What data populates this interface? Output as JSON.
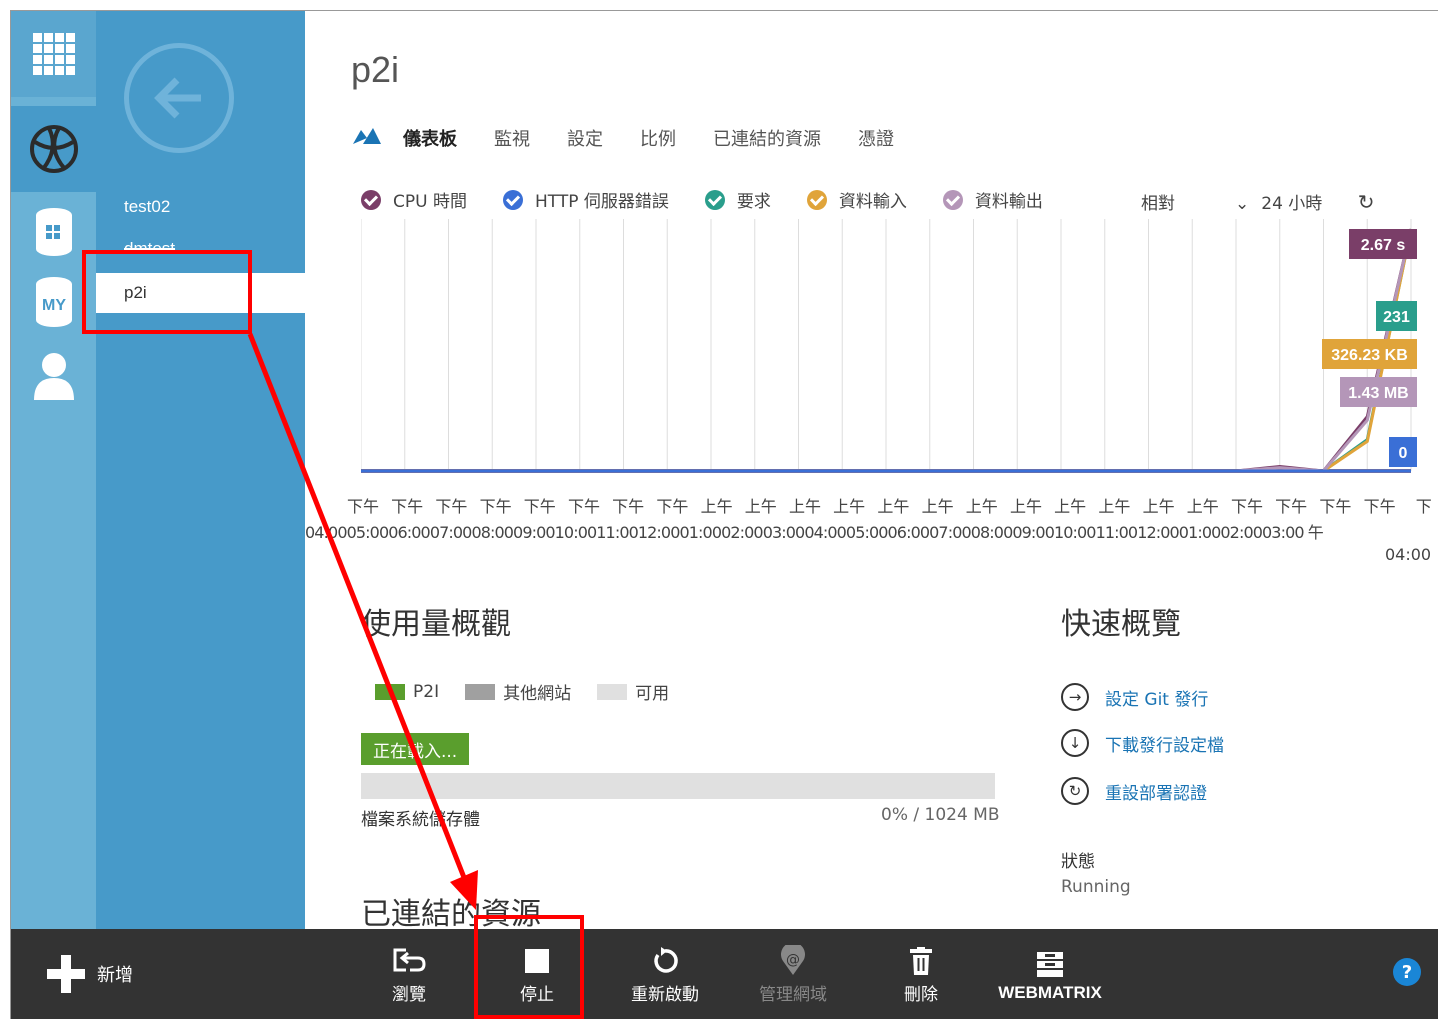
{
  "sidebar": {
    "icons": [
      "all-items-icon",
      "websites-icon",
      "sql-database-icon",
      "my-icon",
      "user-icon"
    ],
    "my_label": "MY",
    "sites": [
      {
        "label": "test02"
      },
      {
        "label": "dmtest"
      },
      {
        "label": "p2i",
        "selected": true
      }
    ]
  },
  "page": {
    "title": "p2i",
    "tabs": [
      "儀表板",
      "監視",
      "設定",
      "比例",
      "已連結的資源",
      "憑證"
    ],
    "active_tab": "儀表板"
  },
  "metrics": {
    "legend": [
      {
        "label": "CPU 時間",
        "color": "#7a3e68"
      },
      {
        "label": "HTTP 伺服器錯誤",
        "color": "#3a6fd6"
      },
      {
        "label": "要求",
        "color": "#2a9e8c"
      },
      {
        "label": "資料輸入",
        "color": "#e0a43a"
      },
      {
        "label": "資料輸出",
        "color": "#b496b8"
      }
    ],
    "mode": "相對",
    "range": "24 小時"
  },
  "chart_data": {
    "type": "line",
    "x": [
      "下午 04:00",
      "下午 05:00",
      "下午 06:00",
      "下午 07:00",
      "下午 08:00",
      "下午 09:00",
      "下午 10:00",
      "下午 11:00",
      "上午 12:00",
      "上午 01:00",
      "上午 02:00",
      "上午 03:00",
      "上午 04:00",
      "上午 05:00",
      "上午 06:00",
      "上午 07:00",
      "上午 08:00",
      "上午 09:00",
      "上午 10:00",
      "上午 11:00",
      "下午 12:00",
      "下午 01:00",
      "下午 02:00",
      "下午 03:00",
      "下午 04:00"
    ],
    "x_top": [
      "下午",
      "下午",
      "下午",
      "下午",
      "下午",
      "下午",
      "下午",
      "下午",
      "上午",
      "上午",
      "上午",
      "上午",
      "上午",
      "上午",
      "上午",
      "上午",
      "上午",
      "上午",
      "上午",
      "上午",
      "下午",
      "下午",
      "下午",
      "下午",
      "下"
    ],
    "x_bottom": [
      "04:00",
      "05:00",
      "06:00",
      "07:00",
      "08:00",
      "09:00",
      "10:00",
      "11:00",
      "12:00",
      "01:00",
      "02:00",
      "03:00",
      "04:00",
      "05:00",
      "06:00",
      "07:00",
      "08:00",
      "09:00",
      "10:00",
      "11:00",
      "12:00",
      "01:00",
      "02:00",
      "03:00"
    ],
    "x_tail": [
      "午",
      "04:00"
    ],
    "series": [
      {
        "name": "CPU 時間",
        "color": "#7a3e68",
        "values": [
          0,
          0,
          0,
          0,
          0,
          0,
          0,
          0,
          0,
          0,
          0,
          0,
          0,
          0,
          0,
          0,
          0,
          0,
          0,
          0,
          0,
          0.05,
          0,
          0.6,
          2.67
        ],
        "label": "2.67 s"
      },
      {
        "name": "要求",
        "color": "#2a9e8c",
        "values": [
          0,
          0,
          0,
          0,
          0,
          0,
          0,
          0,
          0,
          0,
          0,
          0,
          0,
          0,
          0,
          0,
          0,
          0,
          0,
          0,
          0,
          0,
          0,
          30,
          231
        ],
        "label": "231"
      },
      {
        "name": "資料輸入",
        "color": "#e0a43a",
        "values": [
          0,
          0,
          0,
          0,
          0,
          0,
          0,
          0,
          0,
          0,
          0,
          0,
          0,
          0,
          0,
          0,
          0,
          0,
          0,
          0,
          0,
          0,
          0,
          40,
          326.23
        ],
        "label": "326.23 KB"
      },
      {
        "name": "資料輸出",
        "color": "#b496b8",
        "values": [
          0,
          0,
          0,
          0,
          0,
          0,
          0,
          0,
          0,
          0,
          0,
          0,
          0,
          0,
          0,
          0,
          0,
          0,
          0,
          0,
          0,
          0.02,
          0,
          0.3,
          1.43
        ],
        "label": "1.43 MB"
      },
      {
        "name": "HTTP 伺服器錯誤",
        "color": "#3a6fd6",
        "values": [
          0,
          0,
          0,
          0,
          0,
          0,
          0,
          0,
          0,
          0,
          0,
          0,
          0,
          0,
          0,
          0,
          0,
          0,
          0,
          0,
          0,
          0,
          0,
          0,
          0
        ],
        "label": "0"
      }
    ]
  },
  "usage": {
    "heading": "使用量概觀",
    "legend": [
      {
        "label": "P2I",
        "color": "#5a9e2d"
      },
      {
        "label": "其他網站",
        "color": "#a0a0a0"
      },
      {
        "label": "可用",
        "color": "#e0e0e0"
      }
    ],
    "loading": "正在載入...",
    "bar_label": "檔案系統儲存體",
    "bar_value": "0% / 1024 MB",
    "bar_percent": 0
  },
  "quick": {
    "heading": "快速概覽",
    "links": [
      {
        "label": "設定 Git 發行",
        "icon": "arrow-right-circle-icon"
      },
      {
        "label": "下載發行設定檔",
        "icon": "download-circle-icon"
      },
      {
        "label": "重設部署認證",
        "icon": "reset-circle-icon"
      }
    ],
    "status_label": "狀態",
    "status_value": "Running"
  },
  "linked": {
    "heading": "已連結的資源"
  },
  "commandbar": {
    "new_label": "新增",
    "commands": [
      {
        "label": "瀏覽",
        "icon": "browse-icon"
      },
      {
        "label": "停止",
        "icon": "stop-icon"
      },
      {
        "label": "重新啟動",
        "icon": "restart-icon"
      },
      {
        "label": "管理網域",
        "icon": "manage-domains-icon",
        "disabled": true
      },
      {
        "label": "刪除",
        "icon": "delete-icon"
      },
      {
        "label": "WEBMATRIX",
        "icon": "webmatrix-icon"
      }
    ],
    "help": "?"
  }
}
